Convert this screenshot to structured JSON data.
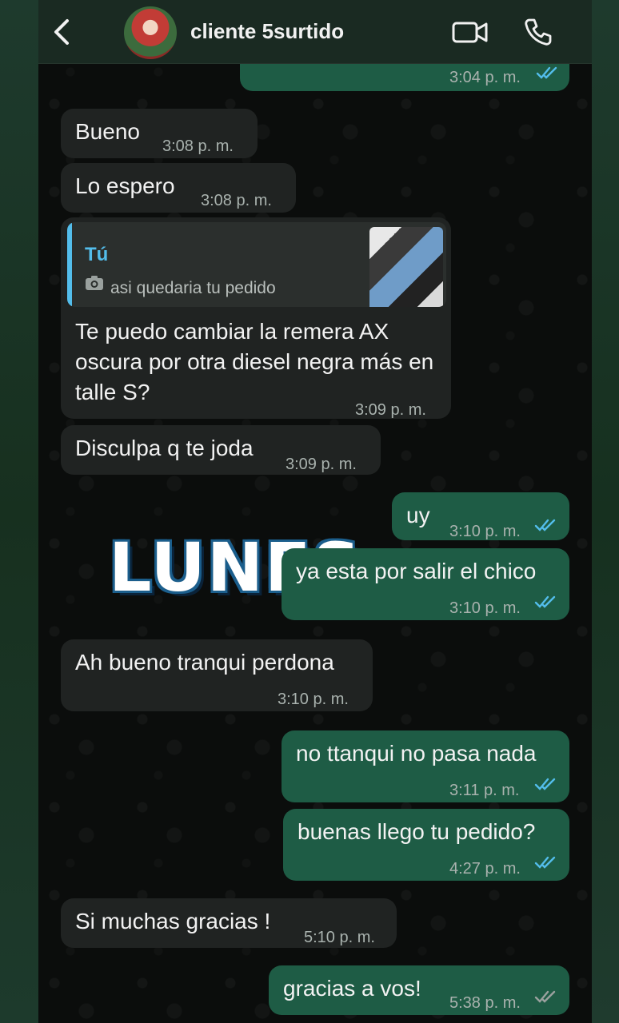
{
  "header": {
    "contact_name": "cliente 5surtido"
  },
  "messages": [
    {
      "dir": "out",
      "text": "",
      "time": "3:04 p. m.",
      "read": true
    },
    {
      "dir": "in",
      "text": "Bueno",
      "time": "3:08 p. m."
    },
    {
      "dir": "in",
      "text": "Lo espero",
      "time": "3:08 p. m."
    },
    {
      "dir": "in",
      "quote_author": "Tú",
      "quote_text": "asi quedaria tu pedido",
      "text": "Te puedo cambiar la remera AX oscura por otra diesel negra más en talle S?",
      "time": "3:09 p. m."
    },
    {
      "dir": "in",
      "text": "Disculpa q te joda",
      "time": "3:09 p. m."
    },
    {
      "dir": "out",
      "text": "uy",
      "time": "3:10 p. m.",
      "read": true
    },
    {
      "dir": "out",
      "text": "ya esta por salir el chico",
      "time": "3:10 p. m.",
      "read": true
    },
    {
      "dir": "in",
      "text": "Ah bueno tranqui perdona",
      "time": "3:10 p. m."
    },
    {
      "dir": "out",
      "text": "no ttanqui no pasa nada",
      "time": "3:11 p. m.",
      "read": true
    },
    {
      "dir": "out",
      "text": "buenas llego tu pedido?",
      "time": "4:27 p. m.",
      "read": true
    },
    {
      "dir": "in",
      "text": "Si muchas gracias !",
      "time": "5:10 p. m."
    },
    {
      "dir": "out",
      "text": "gracias a vos!",
      "time": "5:38 p. m.",
      "read": false
    }
  ],
  "sticker_text": "LUNES",
  "colors": {
    "incoming_bubble": "#202322",
    "outgoing_bubble": "#1e5c45",
    "read_ticks": "#53bdeb",
    "quote_accent": "#53bdeb"
  },
  "icons": [
    "back-arrow-icon",
    "video-call-icon",
    "phone-call-icon",
    "camera-icon",
    "double-check-icon"
  ]
}
